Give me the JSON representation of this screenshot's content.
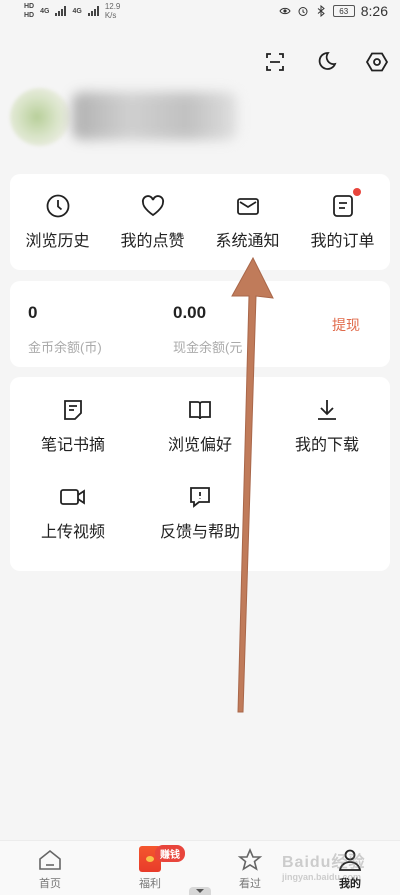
{
  "status_bar": {
    "net1": "HD",
    "net2": "HD",
    "net_type_1": "4G",
    "net_type_2": "4G",
    "speed_value": "12.9",
    "speed_unit": "K/s",
    "battery": "63",
    "time": "8:26"
  },
  "top_icons": [
    "scan-icon",
    "moon-icon",
    "settings-icon"
  ],
  "quick_actions": [
    {
      "label": "浏览历史",
      "icon": "clock-icon"
    },
    {
      "label": "我的点赞",
      "icon": "heart-icon"
    },
    {
      "label": "系统通知",
      "icon": "mail-icon"
    },
    {
      "label": "我的订单",
      "icon": "order-icon",
      "has_dot": true
    }
  ],
  "wallet": {
    "coins_value": "0",
    "coins_label": "金币余额(币)",
    "cash_value": "0.00",
    "cash_label": "现金余额(元",
    "withdraw_label": "提现"
  },
  "tools": [
    {
      "label": "笔记书摘",
      "icon": "note-icon"
    },
    {
      "label": "浏览偏好",
      "icon": "book-icon"
    },
    {
      "label": "我的下载",
      "icon": "download-icon"
    },
    {
      "label": "上传视频",
      "icon": "video-icon"
    },
    {
      "label": "反馈与帮助",
      "icon": "feedback-icon"
    }
  ],
  "bottom_nav": [
    {
      "label": "首页",
      "icon": "home-icon"
    },
    {
      "label": "福利",
      "icon": "red-envelope-icon",
      "badge": "赚钱"
    },
    {
      "label": "看过",
      "icon": "star-icon"
    },
    {
      "label": "我的",
      "icon": "user-icon",
      "active": true
    }
  ],
  "watermark": {
    "text": "Baidu经验",
    "sub": "jingyan.baidu.com"
  },
  "colors": {
    "accent": "#e06a4a",
    "badge": "#e8453c",
    "arrow": "#c07b5a",
    "background": "#f5f5f5"
  }
}
